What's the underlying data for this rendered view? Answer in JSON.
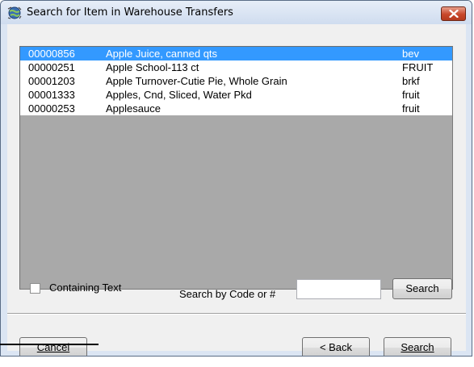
{
  "window": {
    "title": "Search for Item in Warehouse Transfers",
    "icon": "app-globe-icon",
    "close_icon": "close-icon"
  },
  "list": {
    "rows": [
      {
        "code": "00000856",
        "name": "Apple Juice, canned qts",
        "category": "bev",
        "selected": true
      },
      {
        "code": "00000251",
        "name": "Apple School-113 ct",
        "category": "FRUIT",
        "selected": false
      },
      {
        "code": "00001203",
        "name": "Apple Turnover-Cutie Pie, Whole Grain",
        "category": "brkf",
        "selected": false
      },
      {
        "code": "00001333",
        "name": "Apples, Cnd, Sliced, Water Pkd",
        "category": "fruit",
        "selected": false
      },
      {
        "code": "00000253",
        "name": "Applesauce",
        "category": "fruit",
        "selected": false
      }
    ]
  },
  "filters": {
    "containing_text_label": "Containing Text",
    "containing_text_checked": false,
    "search_by_label": "Search by Code or #",
    "search_value": "",
    "search_button": "Search"
  },
  "footer": {
    "cancel_label": "Cancel",
    "back_label": "< Back",
    "search_label": "Search"
  },
  "colors": {
    "selection": "#3399ff",
    "list_background": "#a9a9a9",
    "client_background": "#f0f0f0",
    "titlebar": "#dbe5f3",
    "close_button": "#c8472a"
  }
}
